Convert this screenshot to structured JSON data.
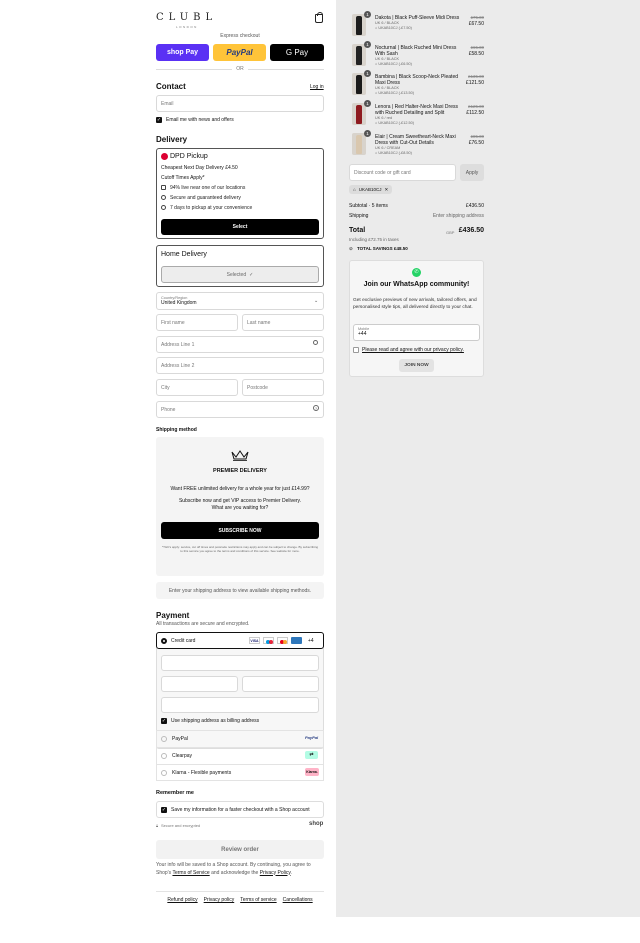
{
  "brand": {
    "logo": "CLUBL",
    "subtitle": "LONDON"
  },
  "express": {
    "label": "Express checkout",
    "or": "OR",
    "shop_pay": "shop Pay",
    "paypal": "PayPal",
    "gpay": "G Pay"
  },
  "contact": {
    "title": "Contact",
    "login": "Log in",
    "email_placeholder": "Email",
    "newsletter": "Email me with news and offers"
  },
  "delivery": {
    "title": "Delivery",
    "dpd": {
      "name": "DPD Pickup",
      "price_line": "Cheapest Next Day Delivery £4.50",
      "cutoff": "Cutoff Times Apply*",
      "features": [
        "94% live near one of our locations",
        "Secure and guaranteed delivery",
        "7 days to pickup at your convenience"
      ],
      "select": "Select"
    },
    "home": {
      "name": "Home Delivery",
      "selected": "Selected"
    },
    "country_label": "Country/Region",
    "country_value": "United Kingdom",
    "first_name": "First name",
    "last_name": "Last name",
    "address1": "Address Line 1",
    "address2": "Address Line 2",
    "city": "City",
    "postcode": "Postcode",
    "phone": "Phone"
  },
  "shipping": {
    "title": "Shipping method",
    "premier_title": "PREMIER DELIVERY",
    "premier_line1": "Want FREE unlimited delivery for a whole year for just £14.99?",
    "premier_line2": "Subscribe now and get VIP access to Premier Delivery.",
    "premier_line3": "What are you waiting for?",
    "subscribe": "SUBSCRIBE NOW",
    "fineprint": "*T&C's apply: service, cut off times and postcode restrictions may apply and can be subject to change. By subscribing to this service you agree to the terms and conditions of this service. See website for more.",
    "notice": "Enter your shipping address to view available shipping methods."
  },
  "payment": {
    "title": "Payment",
    "subtitle": "All transactions are secure and encrypted.",
    "credit_card": "Credit card",
    "card_more": "+4",
    "billing": "Use shipping address as billing address",
    "paypal": "PayPal",
    "paypal_logo": "PayPal",
    "clearpay": "Clearpay",
    "klarna": "Klarna - Flexible payments",
    "klarna_logo": "Klarna."
  },
  "remember": {
    "title": "Remember me",
    "save": "Save my information for a faster checkout with a Shop account",
    "secure": "Secure and encrypted",
    "shop_logo": "shop"
  },
  "review": {
    "button": "Review order",
    "legal_prefix": "Your info will be saved to a Shop account. By continuing, you agree to Shop's",
    "terms": "Terms of Service",
    "legal_mid": "and acknowledge the",
    "privacy": "Privacy Policy",
    "legal_end": "."
  },
  "footer": [
    "Refund policy",
    "Privacy policy",
    "Terms of service",
    "Cancellations"
  ],
  "cart": {
    "items": [
      {
        "qty": "1",
        "name": "Dakota | Black Puff-Sleeve Midi Dress",
        "variant": "UK 6 / BLACK",
        "code": "UKAB10CJ (-£7.50)",
        "old": "£75.00",
        "price": "£67.50",
        "color": "#1c1c1c"
      },
      {
        "qty": "1",
        "name": "Nocturnal | Black Ruched Mini Dress With Sash",
        "variant": "UK 6 / BLACK",
        "code": "UKAB10CJ (-£6.50)",
        "old": "£65.00",
        "price": "£58.50",
        "color": "#222"
      },
      {
        "qty": "1",
        "name": "Bambina | Black Scoop-Neck Pleated Maxi Dress",
        "variant": "UK 6 / BLACK",
        "code": "UKAB10CJ (-£13.50)",
        "old": "£135.00",
        "price": "£121.50",
        "color": "#1a1a1a"
      },
      {
        "qty": "1",
        "name": "Lenora | Red Halter-Neck Maxi Dress with Ruched Detailing and Split",
        "variant": "UK 6 / red",
        "code": "UKAB10CJ (-£12.50)",
        "old": "£125.00",
        "price": "£112.50",
        "color": "#8e1a1f"
      },
      {
        "qty": "1",
        "name": "Elair | Cream Sweetheart-Neck Maxi Dress with Cut-Out Details",
        "variant": "UK 6 / CREAM",
        "code": "UKAB10CJ (-£8.50)",
        "old": "£85.00",
        "price": "£76.50",
        "color": "#d9c7ae"
      }
    ],
    "discount_placeholder": "Discount code or gift card",
    "apply": "Apply",
    "applied_code": "UKAB10CJ",
    "subtotal_label": "Subtotal · 5 items",
    "subtotal": "£436.50",
    "shipping_label": "Shipping",
    "shipping_value": "Enter shipping address",
    "total_label": "Total",
    "currency": "GBP",
    "total": "£436.50",
    "taxes": "Including £72.75 in taxes",
    "savings_label": "TOTAL SAVINGS",
    "savings": "£48.50"
  },
  "whatsapp": {
    "title": "Join our WhatsApp community!",
    "text": "Get exclusive previews of new arrivals, tailored offers, and personalised style tips, all delivered directly to your chat.",
    "mobile_label": "Mobile",
    "mobile_value": "+44",
    "consent": "Please read and agree with our privacy policy.",
    "join": "JOIN NOW"
  }
}
